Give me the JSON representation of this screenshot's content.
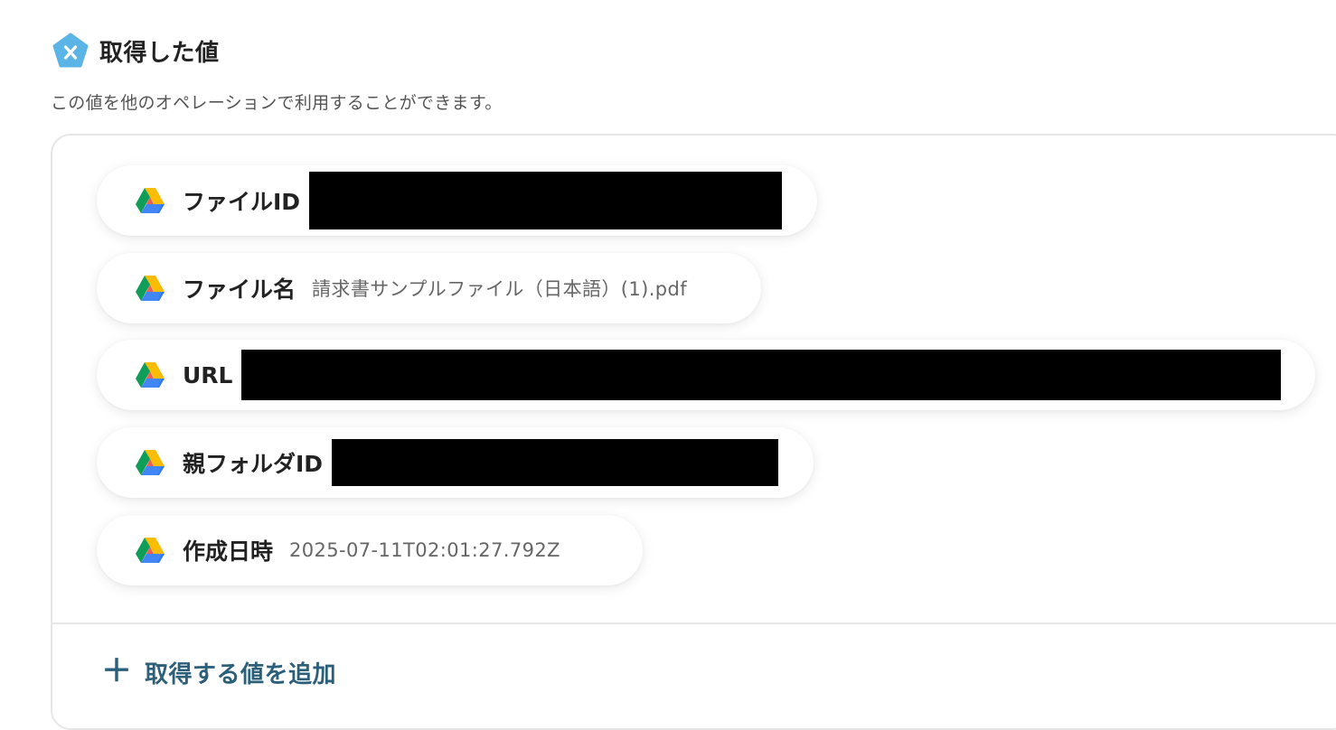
{
  "header": {
    "title": "取得した値",
    "description": "この値を他のオペレーションで利用することができます。",
    "icon": "yoom-pentagon-icon",
    "icon_color": "#5ab4e5"
  },
  "fields": [
    {
      "label": "ファイルID",
      "value": "",
      "redacted": true,
      "icon": "google-drive-icon"
    },
    {
      "label": "ファイル名",
      "value": "請求書サンプルファイル（日本語）(1).pdf",
      "redacted": false,
      "icon": "google-drive-icon"
    },
    {
      "label": "URL",
      "value": "",
      "redacted": true,
      "icon": "google-drive-icon"
    },
    {
      "label": "親フォルダID",
      "value": "",
      "redacted": true,
      "icon": "google-drive-icon"
    },
    {
      "label": "作成日時",
      "value": "2025-07-11T02:01:27.792Z",
      "redacted": false,
      "icon": "google-drive-icon"
    }
  ],
  "add_button": {
    "label": "取得する値を追加",
    "icon": "plus-icon",
    "color": "#2b5f7a"
  }
}
